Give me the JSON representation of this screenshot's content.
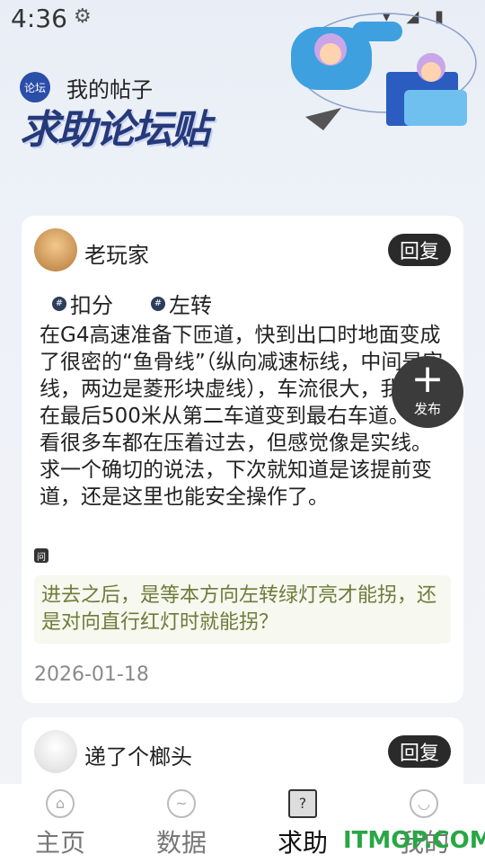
{
  "status_bar": {
    "time": "4:36",
    "gear_glyph": "⚙",
    "icons": "▾ ◢ ▮"
  },
  "header": {
    "logo_text": "论坛",
    "my_posts": "我的帖子",
    "title": "求助论坛贴"
  },
  "posts": [
    {
      "username": "老玩家",
      "reply_label": "回复",
      "tags": [
        "扣分",
        "左转"
      ],
      "body": "在G4高速准备下匝道，快到出口时地面变成了很密的“鱼骨线”（纵向减速标线，中间是实线，两边是菱形块虚线），车流很大，我需要在最后500米从第二车道变到最右车道。我看很多车都在压着过去，但感觉像是实线。求一个确切的说法，下次就知道是该提前变道，还是这里也能安全操作了。",
      "q_label": "问",
      "followup": "进去之后，是等本方向左转绿灯亮才能拐，还是对向直行红灯时就能拐？",
      "date": "2026-01-18"
    },
    {
      "username": "递了个榔头",
      "reply_label": "回复"
    }
  ],
  "fab": {
    "plus": "+",
    "label": "发布"
  },
  "tabs": [
    {
      "label": "主页",
      "icon": "home-icon"
    },
    {
      "label": "数据",
      "icon": "chart-icon"
    },
    {
      "label": "求助",
      "icon": "help-icon"
    },
    {
      "label": "我的",
      "icon": "profile-icon"
    }
  ],
  "watermark": "ITMOP.COM"
}
